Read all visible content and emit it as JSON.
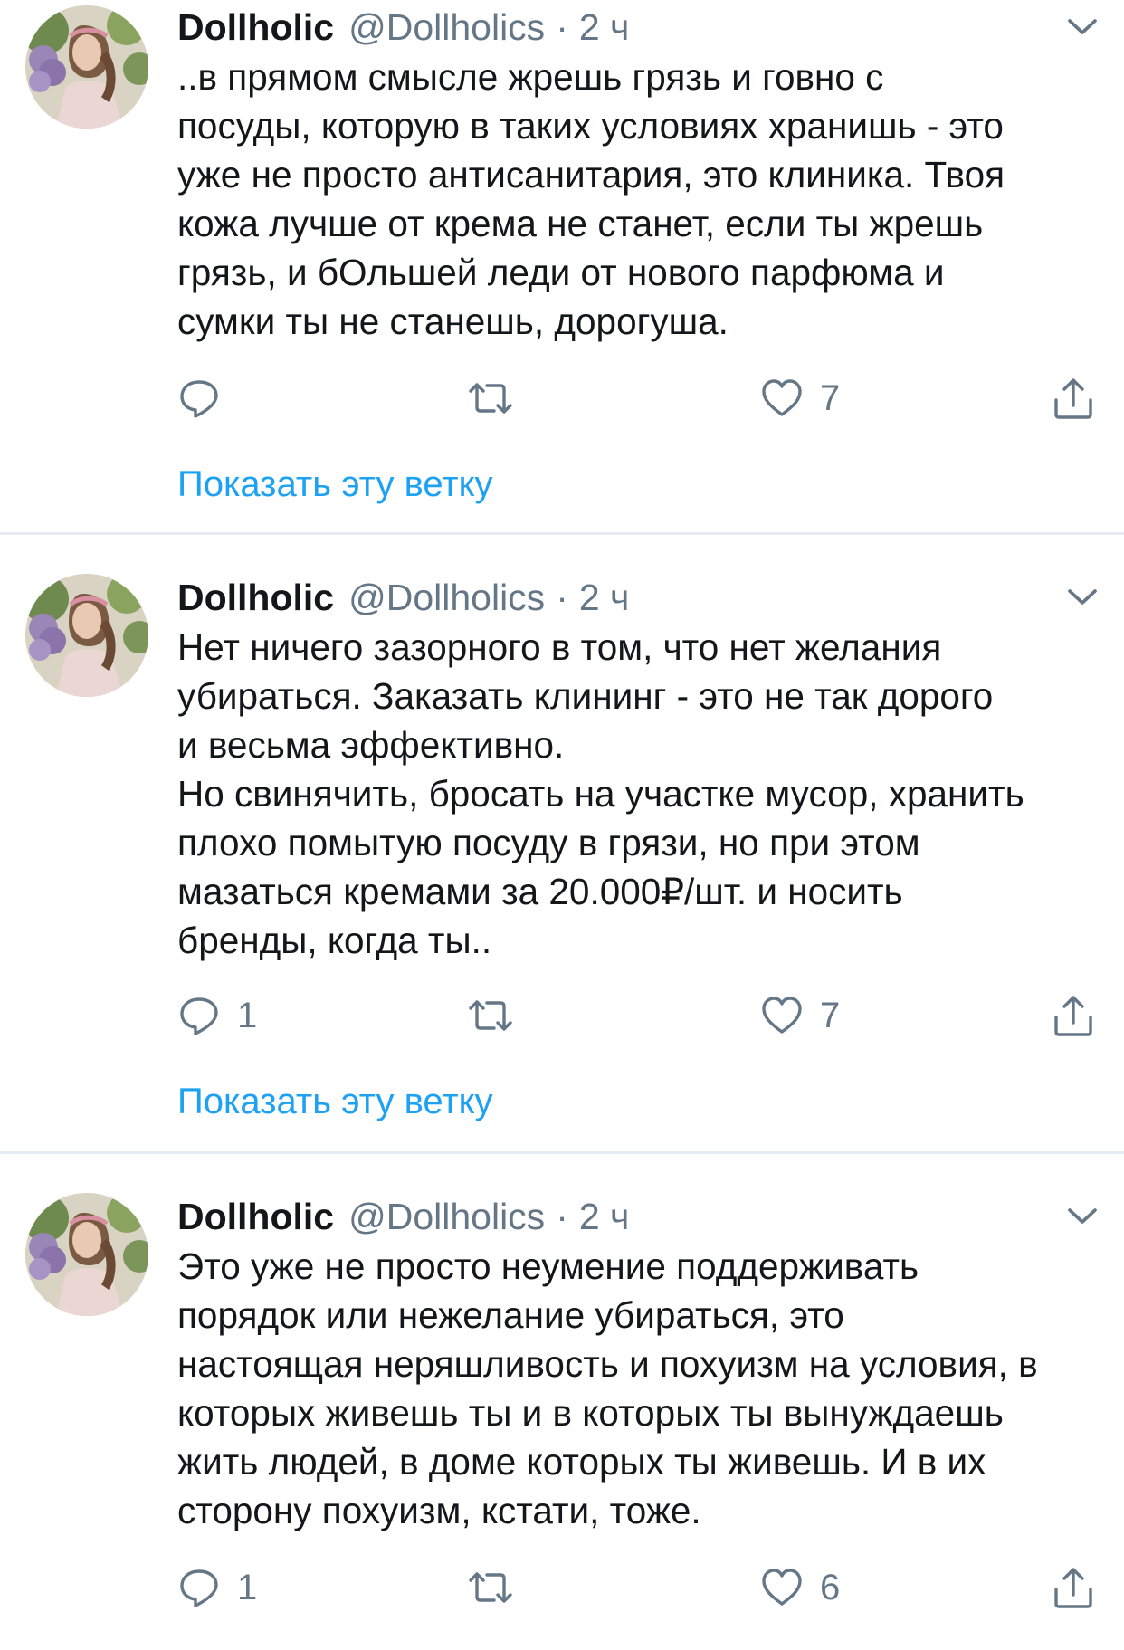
{
  "tweets": [
    {
      "author": {
        "name": "Dollholic",
        "handle": "@Dollholics",
        "separator": "·",
        "time": "2 ч"
      },
      "text": "..в прямом смысле жрешь грязь и говно с\nпосуды, которую в таких условиях хранишь - это\nуже не просто антисанитария, это клиника. Твоя\nкожа лучше от крема не станет, если ты жрешь\nгрязь, и бОльшей леди от нового парфюма и\nсумки ты не станешь, дорогуша.",
      "reply_count": "",
      "retweet_count": "",
      "like_count": "7",
      "show_thread": "Показать эту ветку"
    },
    {
      "author": {
        "name": "Dollholic",
        "handle": "@Dollholics",
        "separator": "·",
        "time": "2 ч"
      },
      "text": "Нет ничего зазорного в том, что нет желания\nубираться. Заказать клининг - это не так дорого\nи весьма эффективно.\nНо свинячить, бросать на участке мусор, хранить\nплохо помытую посуду в грязи, но при этом\nмазаться кремами за 20.000₽/шт. и носить\nбренды, когда ты..",
      "reply_count": "1",
      "retweet_count": "",
      "like_count": "7",
      "show_thread": "Показать эту ветку"
    },
    {
      "author": {
        "name": "Dollholic",
        "handle": "@Dollholics",
        "separator": "·",
        "time": "2 ч"
      },
      "text": "Это уже не просто неумение поддерживать\nпорядок или нежелание убираться, это\nнастоящая неряшливость и похуизм на условия, в\nкоторых живешь ты и в которых ты вынуждаешь\nжить людей, в доме которых ты живешь. И в их\nсторону похуизм, кстати, тоже.",
      "reply_count": "1",
      "retweet_count": "",
      "like_count": "6"
    }
  ],
  "icons": {
    "reply": "reply-icon",
    "retweet": "retweet-icon",
    "like": "heart-icon",
    "share": "share-icon",
    "more": "chevron-down-icon"
  },
  "colors": {
    "text": "#14171a",
    "secondary": "#657786",
    "link": "#1da1f2",
    "divider": "#e6ecf0"
  }
}
